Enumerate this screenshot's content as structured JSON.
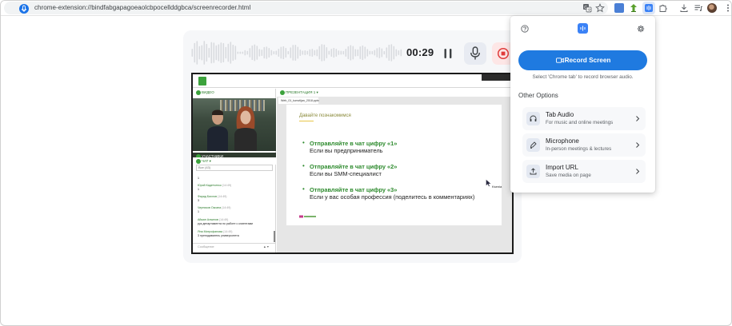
{
  "browser": {
    "url": "chrome-extension://bindfabgapagoeaolcbpocellddgbca/screenrecorder.html",
    "site_icon": "extension-icon",
    "toolbar_icons": [
      "translate-icon",
      "bookmark-star-icon",
      "extension-blue-icon",
      "extension-green-icon",
      "extension-recorder-icon",
      "extensions-puzzle-icon",
      "download-icon",
      "media-queue-icon",
      "profile-avatar",
      "more-menu-icon"
    ]
  },
  "recorder": {
    "timer": "00:29",
    "controls": [
      "pause-icon",
      "microphone-icon",
      "stop-icon"
    ]
  },
  "preview": {
    "left_panel": {
      "video_header": "ВИДЕО",
      "participants_header": "УЧАСТНИКИ",
      "chat_header": "ЧАТ",
      "chat_filter": "Все (43)",
      "messages": [
        {
          "name": "",
          "time": "",
          "text": "1"
        },
        {
          "name": "Юрий Кадетченко",
          "time": "(14:49)",
          "text": "1"
        },
        {
          "name": "Фарид Бахлов",
          "time": "(14:49)",
          "text": "3"
        },
        {
          "name": "Черников Оксана",
          "time": "(14:49)",
          "text": "1"
        },
        {
          "name": "Айжан Ахматов",
          "time": "(14:49)",
          "text": "рук департамента по работе с клиентами"
        },
        {
          "name": "Яна Митрофанова",
          "time": "(14:49)",
          "text": "3 преподаватель университета"
        }
      ],
      "message_placeholder": "Сообщение"
    },
    "right_panel": {
      "header": "ПРЕЗЕНТАЦИЯ 1",
      "tab_name": "Web_01_tumotijan_2018.pptx",
      "slide": {
        "title": "Давайте познакомимся",
        "bullets": [
          {
            "line1": "Отправляйте в чат цифру «1»",
            "line2": "Если вы предприниматель"
          },
          {
            "line1": "Отправляйте в чат цифру «2»",
            "line2": "Если вы SMM-специалист"
          },
          {
            "line1": "Отправляйте в чат цифру «3»",
            "line2": "Если у вас особая профессия (поделитесь в комментариях)"
          }
        ]
      },
      "cursor_label": "Ksenia"
    }
  },
  "popup": {
    "help_icon": "help-circle-icon",
    "logo_icon": "recorder-logo-icon",
    "settings_icon": "gear-icon",
    "record_button": "Record Screen",
    "hint": "Select 'Chrome tab' to record browser audio.",
    "other_options_title": "Other Options",
    "options": [
      {
        "title": "Tab Audio",
        "subtitle": "For music and online meetings",
        "icon": "headphones-icon"
      },
      {
        "title": "Microphone",
        "subtitle": "In-person meetings & lectures",
        "icon": "pen-microphone-icon"
      },
      {
        "title": "Import URL",
        "subtitle": "Save media on page",
        "icon": "upload-icon"
      }
    ]
  },
  "colors": {
    "accent": "#1f7ae0",
    "stop": "#e03b3b",
    "presentation_green": "#2e8b2e"
  }
}
